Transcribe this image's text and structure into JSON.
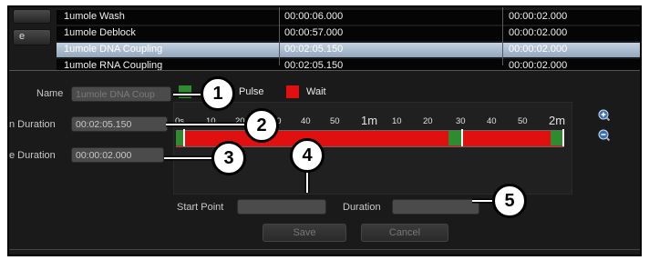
{
  "table": {
    "rows": [
      {
        "name": "1umole Wash",
        "time": "00:00:06.000",
        "wait": "00:00:02.000",
        "selected": false
      },
      {
        "name": "1umole Deblock",
        "time": "00:00:57.000",
        "wait": "00:00:02.000",
        "selected": false
      },
      {
        "name": "1umole DNA Coupling",
        "time": "00:02:05.150",
        "wait": "00:00:02.000",
        "selected": true
      },
      {
        "name": "1umole RNA Coupling",
        "time": "00:02:05.150",
        "wait": "00:00:02.000",
        "selected": false
      }
    ],
    "side_button_label": "e"
  },
  "form": {
    "name_label": "Name",
    "name_value": "1umole DNA Coup",
    "step_duration_label": "n Duration",
    "step_duration_value": "00:02:05.150",
    "wait_duration_label": "e Duration",
    "wait_duration_value": "00:00:02.000",
    "start_point_label": "Start Point",
    "start_point_value": "",
    "duration_label": "Duration",
    "duration_value": "",
    "save_label": "Save",
    "cancel_label": "Cancel"
  },
  "legend": {
    "pulse_label": "Pulse",
    "wait_label": "Wait",
    "pulse_color": "#2e8b2e",
    "wait_color": "#e01010"
  },
  "timeline": {
    "ticks": [
      "0s",
      "10",
      "20",
      "30",
      "40",
      "50",
      "1m",
      "10",
      "20",
      "30",
      "40",
      "50",
      "2m"
    ],
    "zoom_in_icon": "zoom-in-icon",
    "zoom_out_icon": "zoom-out-icon"
  },
  "callouts": [
    "1",
    "2",
    "3",
    "4",
    "5"
  ]
}
